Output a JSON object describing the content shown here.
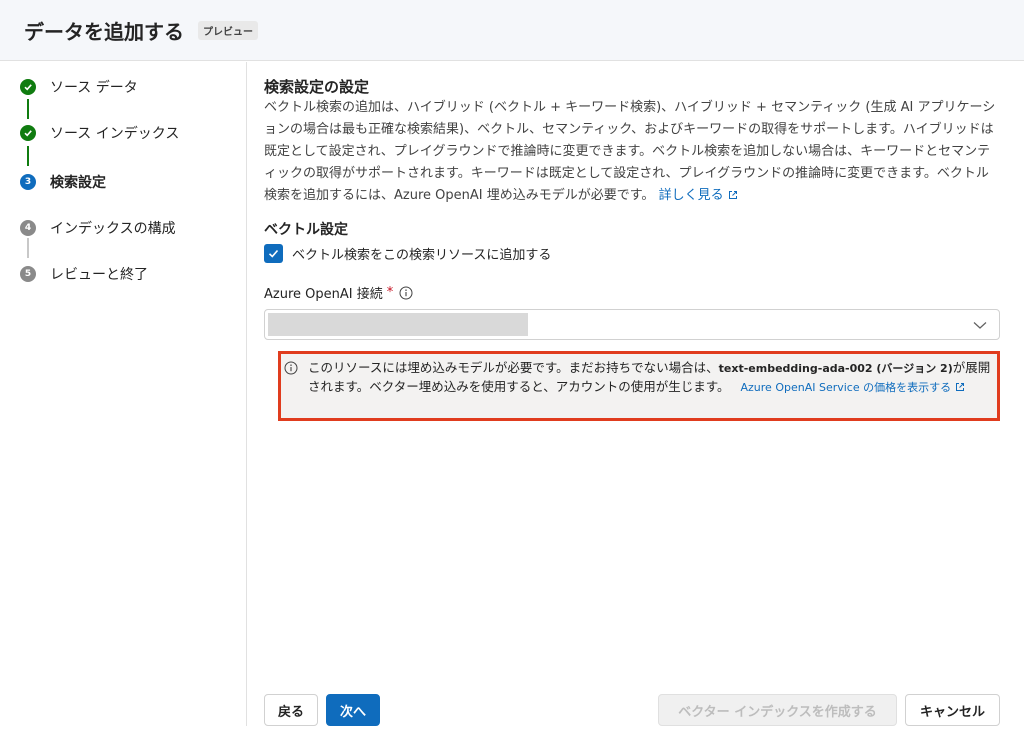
{
  "header": {
    "title": "データを追加する",
    "badge": "プレビュー"
  },
  "steps": [
    {
      "number": "1",
      "label": "ソース データ",
      "status": "complete"
    },
    {
      "number": "2",
      "label": "ソース インデックス",
      "status": "complete"
    },
    {
      "number": "3",
      "label": "検索設定",
      "status": "current"
    },
    {
      "number": "4",
      "label": "インデックスの構成",
      "status": "pending"
    },
    {
      "number": "5",
      "label": "レビューと終了",
      "status": "pending"
    }
  ],
  "main": {
    "section_title": "検索設定の設定",
    "description": "ベクトル検索の追加は、ハイブリッド (ベクトル + キーワード検索)、ハイブリッド + セマンティック (生成 AI アプリケーションの場合は最も正確な検索結果)、ベクトル、セマンティック、およびキーワードの取得をサポートします。ハイブリッドは既定として設定され、プレイグラウンドで推論時に変更できます。ベクトル検索を追加しない場合は、キーワードとセマンティックの取得がサポートされます。キーワードは既定として設定され、プレイグラウンドの推論時に変更できます。ベクトル検索を追加するには、Azure OpenAI 埋め込みモデルが必要です。",
    "learn_more": "詳しく見る",
    "vector_title": "ベクトル設定",
    "checkbox_label": "ベクトル検索をこの検索リソースに追加する",
    "checkbox_checked": true,
    "connection_label": "Azure OpenAI 接続",
    "required_mark": "*",
    "info": {
      "text_before": "このリソースには埋め込みモデルが必要です。まだお持ちでない場合は、",
      "model": "text-embedding-ada-002 (バージョン 2)",
      "text_after": "が展開されます。ベクター埋め込みを使用すると、アカウントの使用が生じます。",
      "link": "Azure OpenAI Service の価格を表示する"
    }
  },
  "footer": {
    "back": "戻る",
    "next": "次へ",
    "create": "ベクター インデックスを作成する",
    "cancel": "キャンセル"
  },
  "colors": {
    "accent": "#0f6cbd",
    "complete": "#107c10",
    "highlight_border": "#e03c1e"
  },
  "icons": [
    "checkmark-icon",
    "info-icon",
    "chevron-down-icon",
    "external-link-icon"
  ]
}
